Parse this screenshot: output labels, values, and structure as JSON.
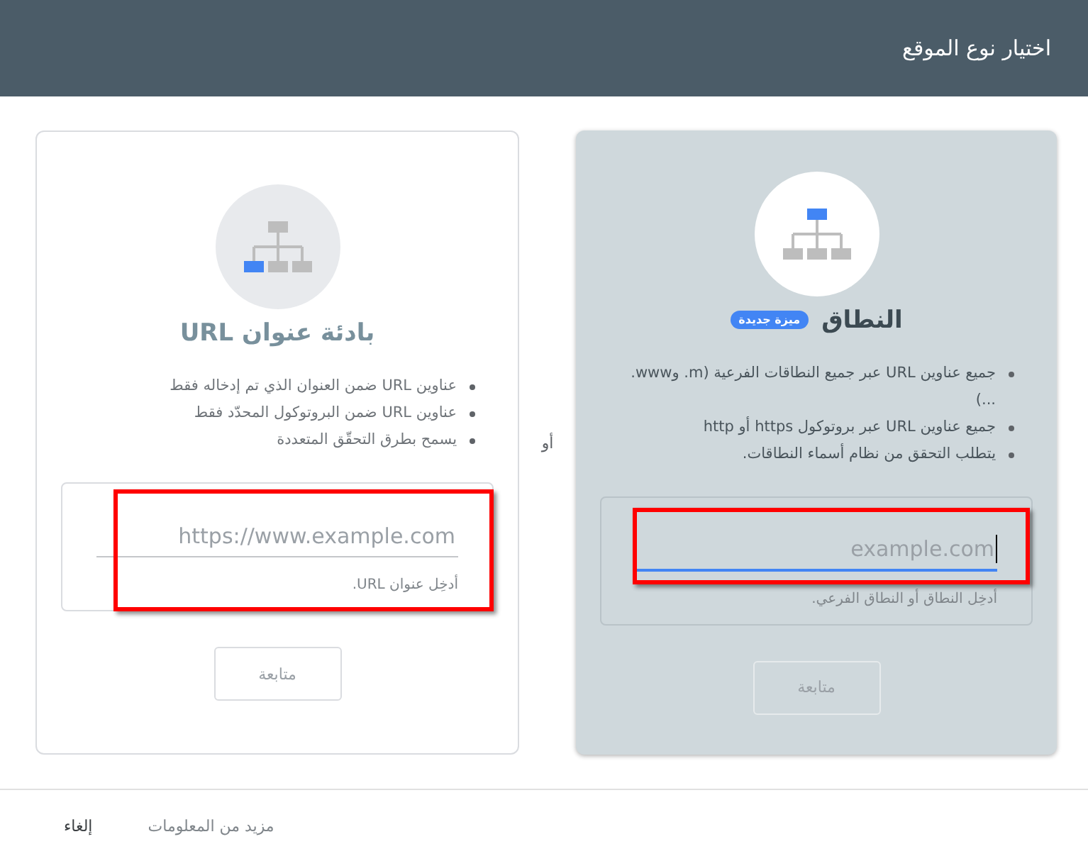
{
  "window": {
    "title": "اختيار نوع الموقع"
  },
  "cards": [
    {
      "kind": "domain",
      "selected": true,
      "title": "النطاق",
      "badge": "ميزة جديدة",
      "features": [
        "جميع عناوين URL عبر جميع النطاقات الفرعية (m. وwww. ...)",
        "جميع عناوين URL عبر بروتوكول https أو http",
        "يتطلب التحقق من نظام أسماء النطاقات."
      ],
      "field": {
        "placeholder": "example.com",
        "focused": true,
        "highlighted": true,
        "hint": "أدخِل النطاق أو النطاق الفرعي."
      },
      "button": {
        "label": "متابعة",
        "disabled": true
      }
    },
    {
      "kind": "url_prefix",
      "selected": false,
      "title": "بادئة عنوان URL",
      "features": [
        "عناوين URL ضمن العنوان الذي تم إدخاله فقط",
        "عناوين URL ضمن البروتوكول المحدّد فقط",
        "يسمح بطرق التحقّق المتعددة"
      ],
      "field": {
        "placeholder": "https://www.example.com",
        "focused": false,
        "highlighted": true,
        "hint": "أدخِل عنوان URL."
      },
      "button": {
        "label": "متابعة",
        "disabled": true
      }
    }
  ],
  "separator": "أو",
  "footer": {
    "links": [
      {
        "label": "مزيد من المعلومات",
        "kind": "link"
      },
      {
        "label": "إلغاء",
        "kind": "action"
      }
    ]
  }
}
